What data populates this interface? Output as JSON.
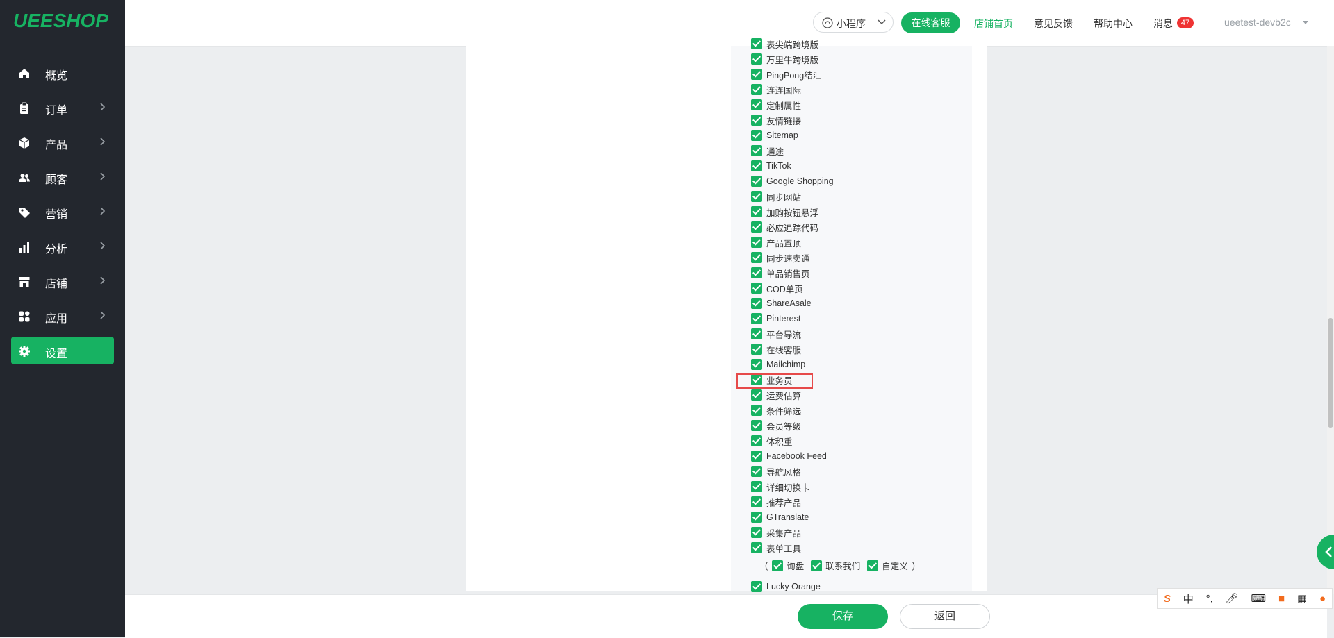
{
  "app": {
    "logo": "UEESHOP"
  },
  "sidebar": {
    "items": [
      {
        "label": "概览",
        "icon": "home-icon"
      },
      {
        "label": "订单",
        "icon": "clipboard-icon"
      },
      {
        "label": "产品",
        "icon": "box-icon"
      },
      {
        "label": "顾客",
        "icon": "users-icon"
      },
      {
        "label": "营销",
        "icon": "tag-icon"
      },
      {
        "label": "分析",
        "icon": "bar-chart-icon"
      },
      {
        "label": "店铺",
        "icon": "store-icon"
      },
      {
        "label": "应用",
        "icon": "apps-icon"
      },
      {
        "label": "设置",
        "icon": "gear-icon",
        "active": true
      }
    ]
  },
  "topbar": {
    "mini_program": "小程序",
    "online_service": "在线客服",
    "store_home": "店铺首页",
    "feedback": "意见反馈",
    "help": "帮助中心",
    "messages": "消息",
    "message_count": "47",
    "account": "ueetest-devb2c"
  },
  "features": [
    "表尖端跨境版",
    "万里牛跨境版",
    "PingPong结汇",
    "连连国际",
    "定制属性",
    "友情链接",
    "Sitemap",
    "通途",
    "TikTok",
    "Google Shopping",
    "同步网站",
    "加购按钮悬浮",
    "必应追踪代码",
    "产品置顶",
    "同步速卖通",
    "单品销售页",
    "COD单页",
    "ShareAsale",
    "Pinterest",
    "平台导流",
    "在线客服",
    "Mailchimp",
    "业务员",
    "运费估算",
    "条件筛选",
    "会员等级",
    "体积重",
    "Facebook Feed",
    "导航风格",
    "详细切换卡",
    "推荐产品",
    "GTranslate",
    "采集产品",
    "表单工具"
  ],
  "form_tools_sub": {
    "open_paren": "(",
    "items": [
      "询盘",
      "联系我们",
      "自定义"
    ],
    "close_paren": ")"
  },
  "after_features": [
    "Lucky Orange"
  ],
  "highlighted_feature": "业务员",
  "footer": {
    "save": "保存",
    "back": "返回"
  },
  "ime": {
    "chinese": "中"
  },
  "colors": {
    "accent": "#17b262",
    "sidebar_bg": "#23272e",
    "highlight": "#e64a4a",
    "badge": "#ef3333"
  }
}
